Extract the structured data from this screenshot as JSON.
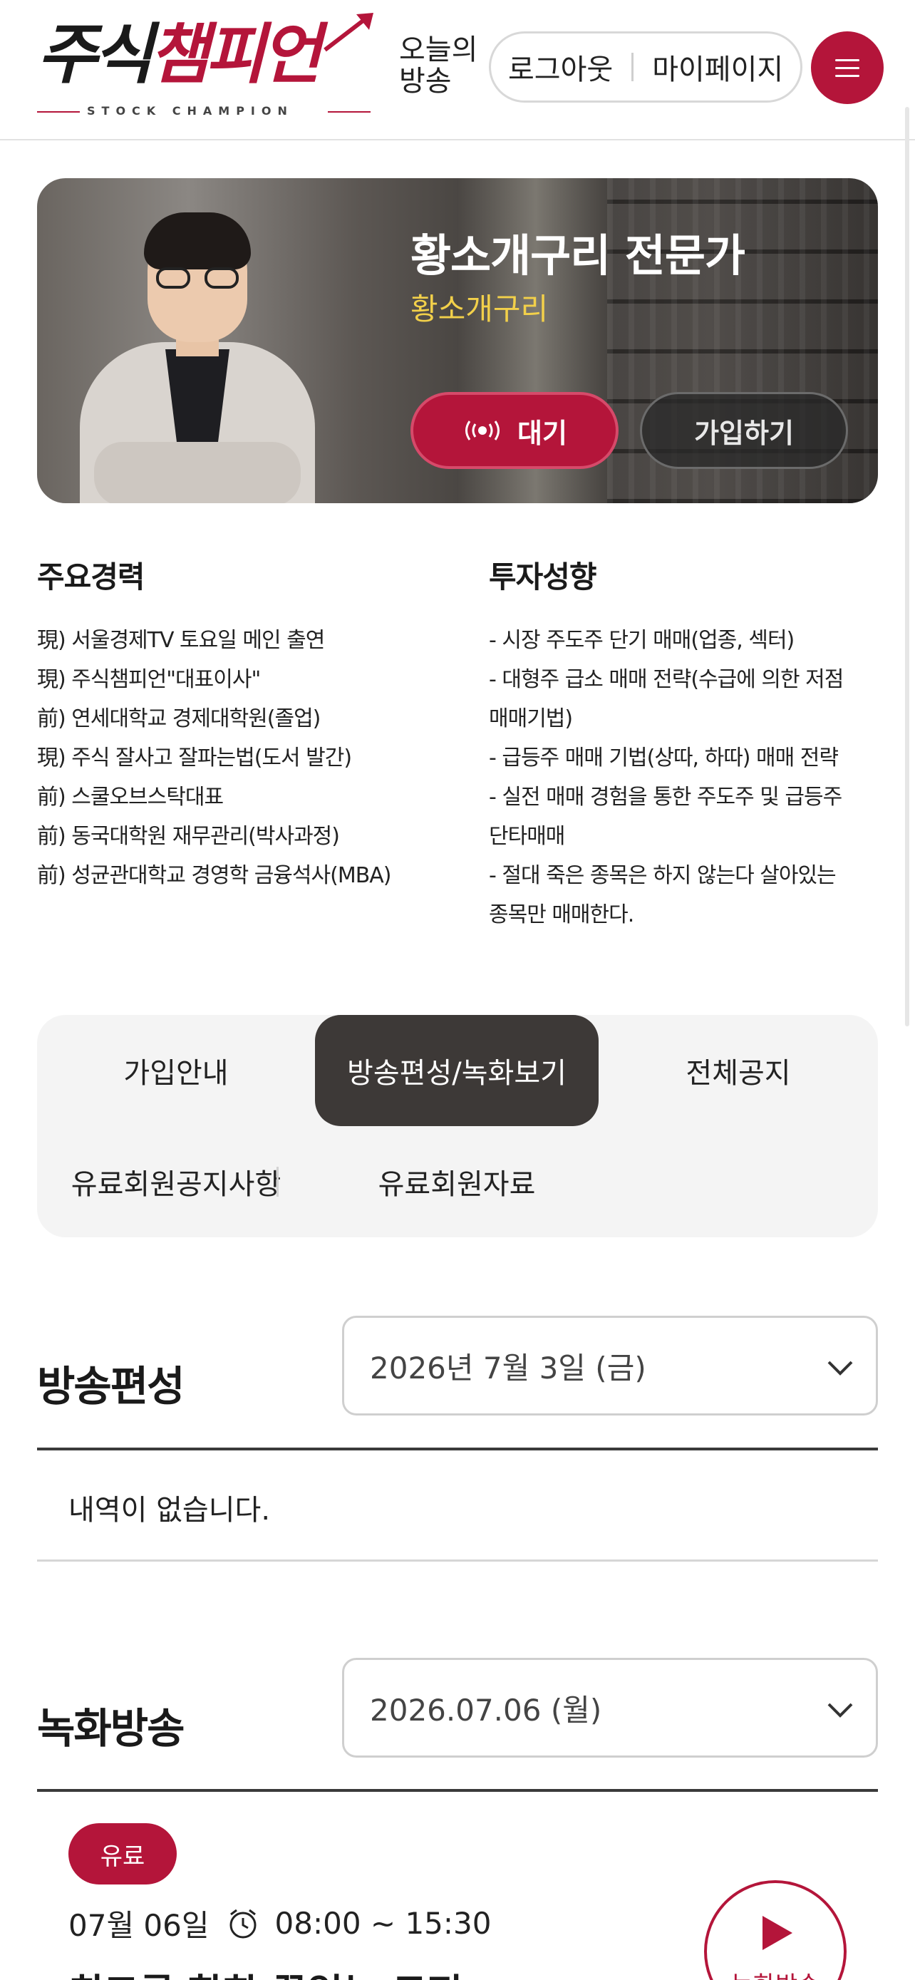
{
  "header": {
    "logo_text_dark": "주식",
    "logo_text_red": "챔피언",
    "logo_sub": "STOCK CHAMPION",
    "today_label": "오늘의 방송",
    "logout_label": "로그아웃",
    "mypage_label": "마이페이지",
    "menu_icon": "hamburger-icon",
    "accent_color": "#b4153a"
  },
  "banner": {
    "title": "황소개구리 전문가",
    "subtitle": "황소개구리",
    "live_label": "대기",
    "live_icon": "broadcast-icon",
    "join_label": "가입하기"
  },
  "career": {
    "heading": "주요경력",
    "items": [
      "現) 서울경제TV 토요일 메인 출연",
      "現) 주식챔피언\"대표이사\"",
      "前) 연세대학교 경제대학원(졸업)",
      "現) 주식 잘사고 잘파는법(도서 발간)",
      "前) 스쿨오브스탁대표",
      "前) 동국대학원 재무관리(박사과정)",
      "前) 성균관대학교 경영학 금융석사(MBA)"
    ]
  },
  "style": {
    "heading": "투자성향",
    "lines": [
      "- 시장 주도주 단기 매매(업종, 섹터)",
      "- 대형주 급소 매매 전략(수급에 의한 저점",
      "매매기법)",
      "- 급등주 매매 기법(상따, 하따) 매매 전략",
      "- 실전 매매 경험을 통한 주도주 및 급등주",
      "단타매매",
      "- 절대 죽은 종목은 하지 않는다 살아있는",
      "종목만 매매한다."
    ]
  },
  "tabs": {
    "join_info": "가입안내",
    "schedule": "방송편성/녹화보기",
    "notice_all": "전체공지",
    "member_notice": "유료회원공지사항",
    "member_data": "유료회원자료",
    "active": "방송편성/녹화보기"
  },
  "schedule": {
    "title": "방송편성",
    "date_value": "2026년 7월 3일 (금)",
    "empty_text": "내역이 없습니다."
  },
  "recording": {
    "title": "녹화방송",
    "date_value": "2026.07.06 (월)",
    "badge": "유료",
    "date": "07월 06일",
    "time": "08:00 ~ 15:30",
    "item_title": "최고를 향한 끝없는 도전",
    "play_label": "녹화방송"
  }
}
